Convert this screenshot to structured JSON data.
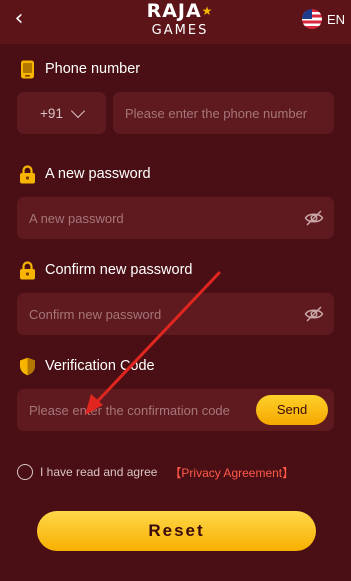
{
  "header": {
    "back_icon": "chevron-left-icon",
    "logo_top": "RAJA",
    "logo_bottom": "GAMES",
    "language": "EN",
    "flag_icon": "us-flag-icon"
  },
  "form": {
    "phone": {
      "label": "Phone number",
      "country_code": "+91",
      "placeholder": "Please enter the phone number",
      "icon": "phone-icon"
    },
    "new_password": {
      "label": "A new password",
      "placeholder": "A new password",
      "icon": "lock-icon",
      "toggle_icon": "eye-off-icon"
    },
    "confirm_password": {
      "label": "Confirm new password",
      "placeholder": "Confirm new password",
      "icon": "lock-icon",
      "toggle_icon": "eye-off-icon"
    },
    "verification": {
      "label": "Verification Code",
      "placeholder": "Please enter the confirmation code",
      "send_label": "Send",
      "icon": "shield-icon"
    },
    "agreement": {
      "text": "I have read and agree",
      "link": "【Privacy Agreement】"
    },
    "reset_label": "Reset"
  },
  "colors": {
    "background": "#4a0f14",
    "field_background": "#5e1a1e",
    "accent": "#f7b000",
    "link": "#ff5a4a",
    "annotation_arrow": "#e0261f"
  }
}
